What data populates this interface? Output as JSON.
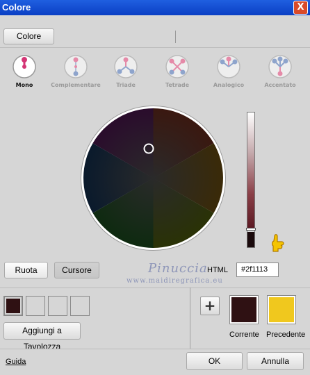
{
  "window": {
    "title": "Colore",
    "close_label": "X"
  },
  "top": {
    "tab_label": "Colore"
  },
  "modes": [
    {
      "label": "Mono",
      "active": true
    },
    {
      "label": "Complementare",
      "active": false
    },
    {
      "label": "Triade",
      "active": false
    },
    {
      "label": "Tetrade",
      "active": false
    },
    {
      "label": "Analogico",
      "active": false
    },
    {
      "label": "Accentato",
      "active": false
    }
  ],
  "view": {
    "ruota_label": "Ruota",
    "cursore_label": "Cursore"
  },
  "watermark": {
    "name": "Pinuccia",
    "site": "www.maidiregrafica.eu"
  },
  "html": {
    "label": "HTML",
    "value": "#2f1113"
  },
  "palette": {
    "add_label": "Aggiungi a Tavolozza",
    "swatches": [
      "#2f1113",
      "",
      "",
      ""
    ]
  },
  "compare": {
    "plus_label": "+",
    "current_label": "Corrente",
    "current_color": "#2f1113",
    "previous_label": "Precedente",
    "previous_color": "#f0c81e"
  },
  "footer": {
    "help_label": "Guida",
    "ok_label": "OK",
    "cancel_label": "Annulla"
  }
}
